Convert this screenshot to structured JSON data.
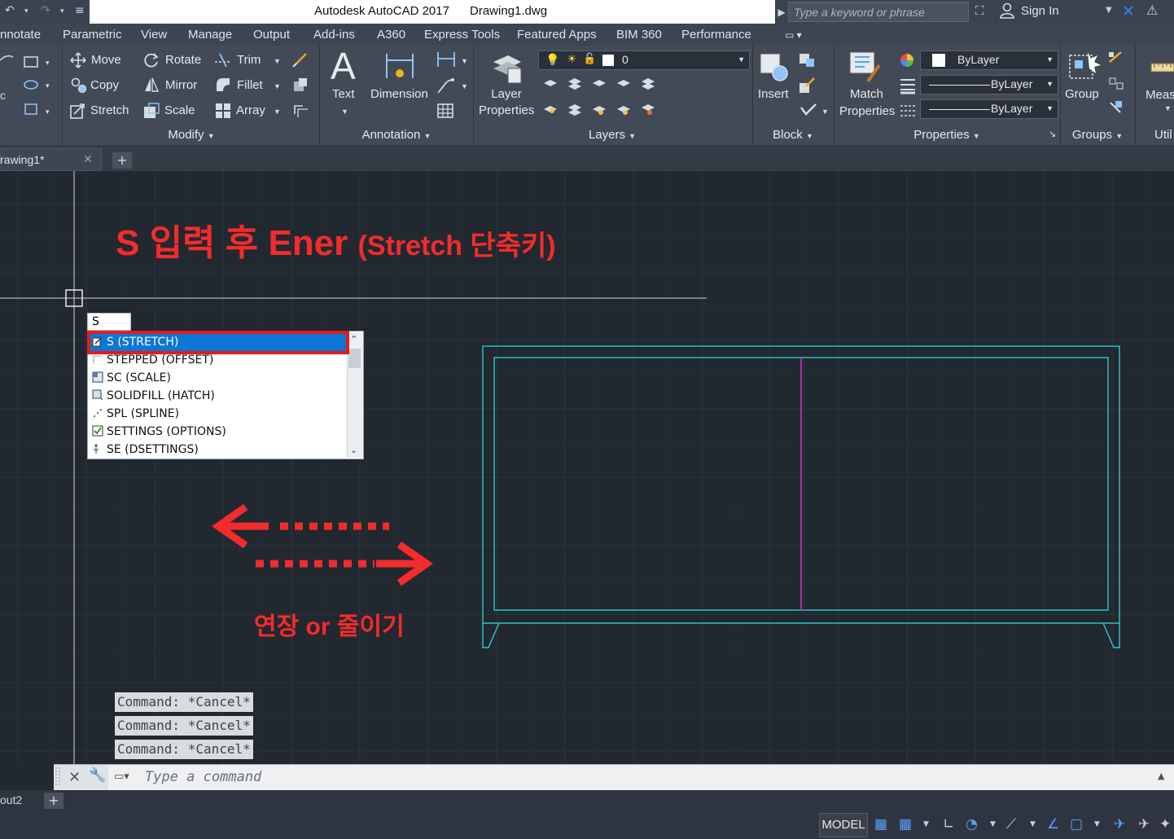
{
  "titlebar": {
    "app_title": "Autodesk AutoCAD 2017",
    "drawing_name": "Drawing1.dwg",
    "search_placeholder": "Type a keyword or phrase",
    "signin_label": "Sign In"
  },
  "ribbon_tabs": [
    "nnotate",
    "Parametric",
    "View",
    "Manage",
    "Output",
    "Add-ins",
    "A360",
    "Express Tools",
    "Featured Apps",
    "BIM 360",
    "Performance"
  ],
  "modify": {
    "move": "Move",
    "rotate": "Rotate",
    "trim": "Trim",
    "copy": "Copy",
    "mirror": "Mirror",
    "fillet": "Fillet",
    "stretch": "Stretch",
    "scale": "Scale",
    "array": "Array",
    "panel_label": "Modify"
  },
  "annotation": {
    "text": "Text",
    "dimension": "Dimension",
    "panel_label": "Annotation"
  },
  "layers": {
    "layer_properties_line1": "Layer",
    "layer_properties_line2": "Properties",
    "current_layer": "0",
    "panel_label": "Layers"
  },
  "block": {
    "insert": "Insert",
    "panel_label": "Block"
  },
  "properties": {
    "match_line1": "Match",
    "match_line2": "Properties",
    "color": "ByLayer",
    "linetype": "ByLayer",
    "lineweight": "ByLayer",
    "panel_label": "Properties"
  },
  "groups": {
    "group": "Group",
    "panel_label": "Groups"
  },
  "utilities": {
    "measure": "Meas",
    "panel_label": "Util"
  },
  "doc_tab": {
    "name": "rawing1*"
  },
  "autocomplete": {
    "typed": "S",
    "items": [
      "S (STRETCH)",
      "STEPPED (OFFSET)",
      "SC (SCALE)",
      "SOLIDFILL (HATCH)",
      "SPL (SPLINE)",
      "SETTINGS (OPTIONS)",
      "SE (DSETTINGS)"
    ]
  },
  "annotations": {
    "title_main": "S 입력 후 Ener ",
    "title_sub": "(Stretch 단축키)",
    "bottom": "연장 or 줄이기"
  },
  "colors": {
    "annotation_red": "#f42b2b",
    "cyan_geometry": "#2ec8d0",
    "magenta_line": "#c437c4",
    "selection_blue": "#0e76d4"
  },
  "history": [
    "Command: *Cancel*",
    "Command: *Cancel*",
    "Command: *Cancel*"
  ],
  "command_line": {
    "placeholder": "Type a command"
  },
  "layout_tab": {
    "name": "out2"
  },
  "statusbar": {
    "model": "MODEL"
  }
}
